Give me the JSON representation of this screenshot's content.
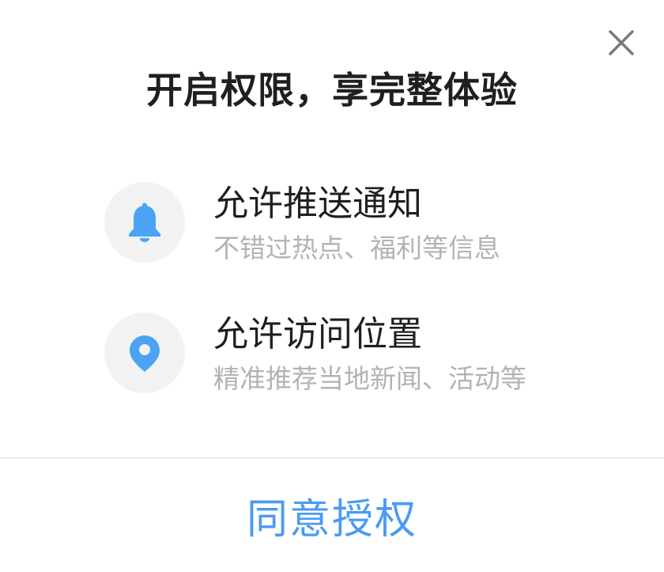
{
  "dialog": {
    "title": "开启权限，享完整体验",
    "close_icon": "close-icon",
    "permissions": [
      {
        "icon": "bell-icon",
        "title": "允许推送通知",
        "description": "不错过热点、福利等信息"
      },
      {
        "icon": "location-pin-icon",
        "title": "允许访问位置",
        "description": "精准推荐当地新闻、活动等"
      }
    ],
    "confirm_label": "同意授权"
  },
  "colors": {
    "accent": "#4a9bf3",
    "icon_blue": "#4aa3f5",
    "icon_circle_bg": "#f2f2f2",
    "title_text": "#1f1f1f",
    "secondary_text": "#b3b3b3",
    "divider": "#ececec"
  }
}
